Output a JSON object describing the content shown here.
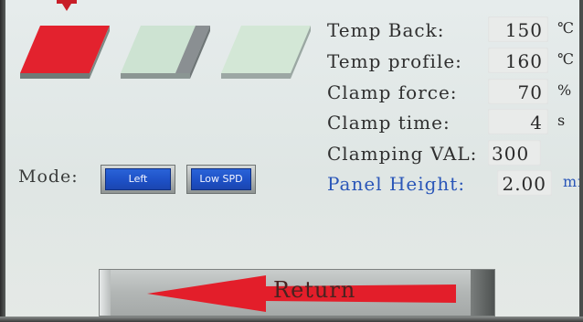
{
  "params": [
    {
      "label": "Temp Back:",
      "value": "150",
      "unit": "℃"
    },
    {
      "label": "Temp profile:",
      "value": "160",
      "unit": "℃"
    },
    {
      "label": "Clamp force:",
      "value": "70",
      "unit": "%"
    },
    {
      "label": "Clamp time:",
      "value": "4",
      "unit": "s"
    },
    {
      "label": "Clamping VAL:",
      "value": "300",
      "unit": ""
    },
    {
      "label": "Panel Height:",
      "value": "2.00",
      "unit": "mm"
    }
  ],
  "mode": {
    "label": "Mode:",
    "side_button": "Left",
    "speed_button": "Low SPD"
  },
  "return_button": {
    "label": "Return"
  },
  "colors": {
    "active_panel": "#e02a36",
    "inactive_panel": "#cfe3d4",
    "button_blue": "#1d4fc4",
    "highlight_text": "#2a56b8",
    "arrow": "#e31e2a"
  }
}
